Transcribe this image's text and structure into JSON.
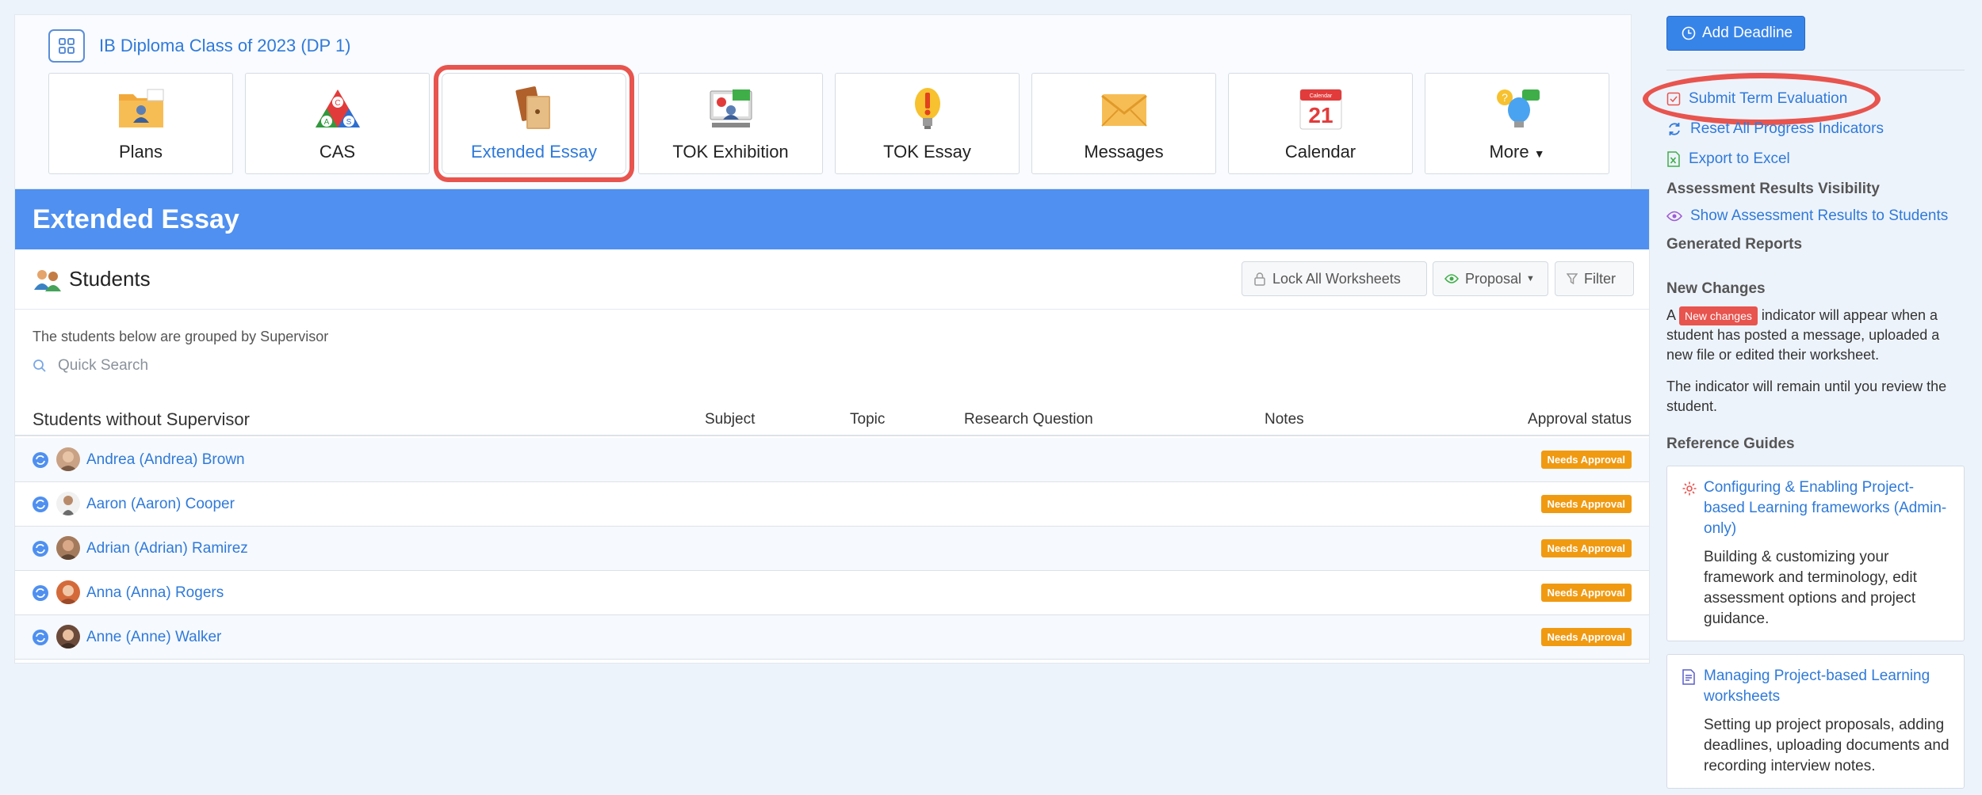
{
  "header": {
    "class_title": "IB Diploma Class of 2023 (DP 1)"
  },
  "tiles": [
    {
      "label": "Plans",
      "icon": "folder-person-icon"
    },
    {
      "label": "CAS",
      "icon": "cas-triangle-icon"
    },
    {
      "label": "Extended Essay",
      "icon": "books-icon",
      "active": true
    },
    {
      "label": "TOK Exhibition",
      "icon": "exhibition-icon"
    },
    {
      "label": "TOK Essay",
      "icon": "lightbulb-exclamation-icon"
    },
    {
      "label": "Messages",
      "icon": "envelope-icon"
    },
    {
      "label": "Calendar",
      "icon": "calendar-icon",
      "calendar_day": "21",
      "calendar_month": "Calendar"
    },
    {
      "label": "More",
      "icon": "lightbulb-chat-icon"
    }
  ],
  "main": {
    "banner_title": "Extended Essay",
    "students_title": "Students",
    "lock_button": "Lock All Worksheets",
    "proposal_button": "Proposal",
    "filter_button": "Filter",
    "group_note": "The students below are grouped by Supervisor",
    "search_placeholder": "Quick Search",
    "columns": {
      "group": "Students without Supervisor",
      "subject": "Subject",
      "topic": "Topic",
      "research": "Research Question",
      "notes": "Notes",
      "approval": "Approval status"
    },
    "students": [
      {
        "name": "Andrea (Andrea) Brown",
        "status": "Needs Approval"
      },
      {
        "name": "Aaron (Aaron) Cooper",
        "status": "Needs Approval"
      },
      {
        "name": "Adrian (Adrian) Ramirez",
        "status": "Needs Approval"
      },
      {
        "name": "Anna (Anna) Rogers",
        "status": "Needs Approval"
      },
      {
        "name": "Anne (Anne) Walker",
        "status": "Needs Approval"
      }
    ]
  },
  "sidebar": {
    "add_deadline": "Add Deadline",
    "submit_term": "Submit Term Evaluation",
    "reset_progress": "Reset All Progress Indicators",
    "export_excel": "Export to Excel",
    "visibility_heading": "Assessment Results Visibility",
    "show_results": "Show Assessment Results to Students",
    "generated_reports": "Generated Reports",
    "new_changes_heading": "New Changes",
    "new_changes_pre": "A",
    "new_changes_badge": "New changes",
    "new_changes_post": "indicator will appear when a student has posted a message, uploaded a new file or edited their worksheet.",
    "indicator_note": "The indicator will remain until you review the student.",
    "reference_heading": "Reference Guides",
    "guides": [
      {
        "title": "Configuring & Enabling Project-based Learning frameworks (Admin-only)",
        "desc": "Building & customizing your framework and terminology, edit assessment options and project guidance."
      },
      {
        "title": "Managing Project-based Learning worksheets",
        "desc": "Setting up project proposals, adding deadlines, uploading documents and recording interview notes."
      }
    ]
  },
  "colors": {
    "accent": "#2f7ad9",
    "banner": "#4f90f0",
    "badge": "#f09a12",
    "highlight": "#e8544e"
  }
}
